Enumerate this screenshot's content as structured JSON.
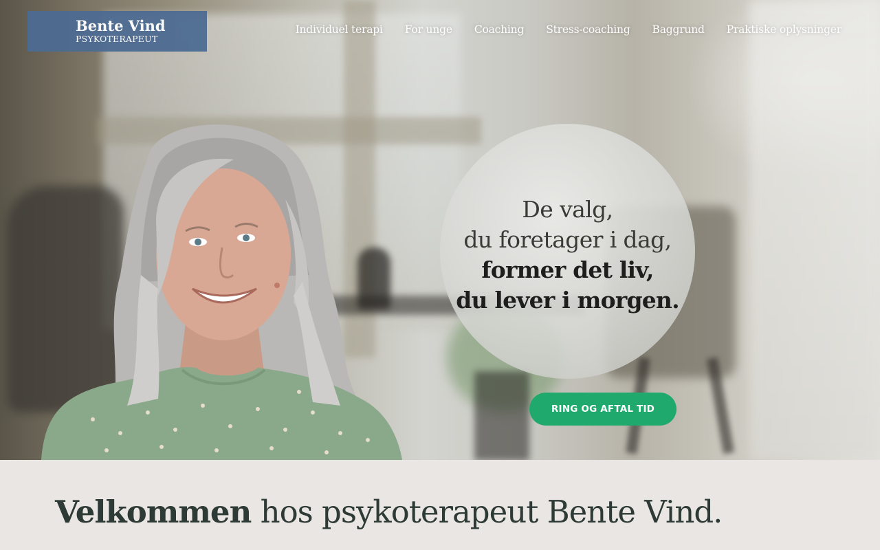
{
  "logo": {
    "name": "Bente Vind",
    "subtitle": "PSYKOTERAPEUT"
  },
  "nav": {
    "items": [
      {
        "label": "Individuel terapi"
      },
      {
        "label": "For unge"
      },
      {
        "label": "Coaching"
      },
      {
        "label": "Stress-coaching"
      },
      {
        "label": "Baggrund"
      },
      {
        "label": "Praktiske oplysninger"
      }
    ]
  },
  "hero": {
    "quote": {
      "line1": "De valg,",
      "line2": "du foretager i dag,",
      "line3": "former det liv,",
      "line4": "du lever i morgen."
    },
    "cta_label": "RING OG AFTAL TID"
  },
  "welcome": {
    "bold": "Velkommen",
    "rest": " hos psykoterapeut Bente Vind."
  },
  "colors": {
    "logo_bg": "#4d6b92",
    "cta_bg": "#1fa96c",
    "page_bg": "#eae6e3",
    "heading": "#2e3a36"
  }
}
